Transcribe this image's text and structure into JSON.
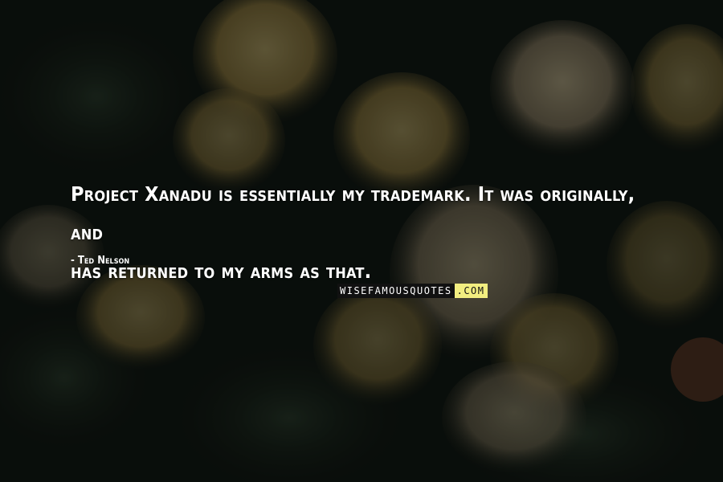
{
  "quote": {
    "line1": "Project Xanadu is essentially my trademark. It was originally, and",
    "line2": "has returned to my arms as that."
  },
  "author": "- Ted Nelson",
  "watermark": {
    "part1": "WISEFAMOUSQUOTES",
    "part2": ".COM"
  }
}
